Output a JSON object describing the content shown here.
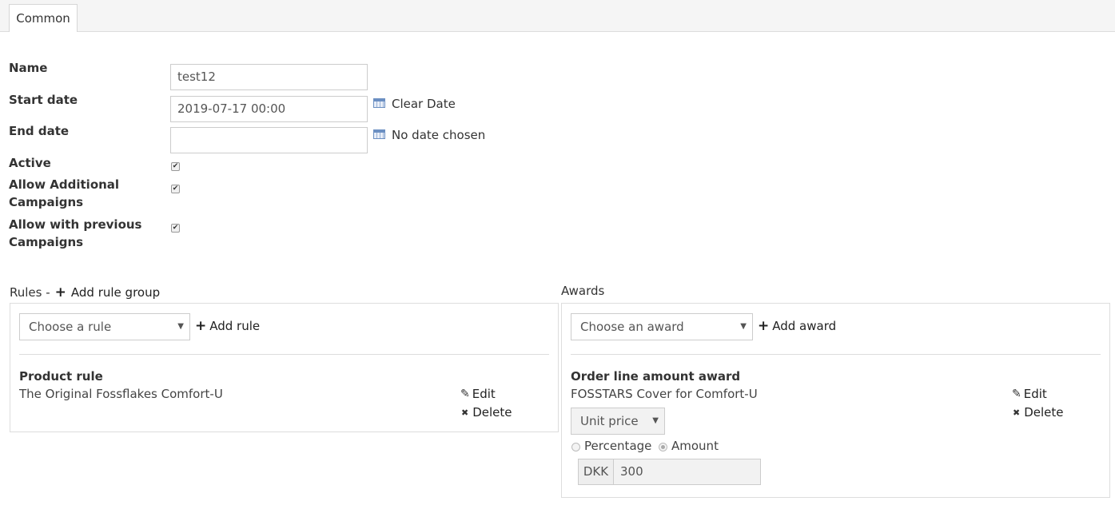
{
  "tabs": [
    {
      "label": "Common"
    }
  ],
  "form": {
    "name_label": "Name",
    "name_value": "test12",
    "start_label": "Start date",
    "start_value": "2019-07-17 00:00",
    "start_link": "Clear Date",
    "end_label": "End date",
    "end_value": "",
    "end_link": "No date chosen",
    "active_label": "Active",
    "active_checked": true,
    "allow_additional_label_1": "Allow Additional",
    "allow_additional_label_2": "Campaigns",
    "allow_additional_checked": true,
    "allow_previous_label_1": "Allow with previous",
    "allow_previous_label_2": "Campaigns",
    "allow_previous_checked": true
  },
  "rules": {
    "title": "Rules -",
    "add_group_label": "Add rule group",
    "select_placeholder": "Choose a rule",
    "add_label": "Add rule",
    "items": [
      {
        "title": "Product rule",
        "subtitle": "The Original Fossflakes Comfort-U",
        "edit": "Edit",
        "delete": "Delete"
      }
    ]
  },
  "awards": {
    "title": "Awards",
    "select_placeholder": "Choose an award",
    "add_label": "Add award",
    "items": [
      {
        "title": "Order line amount award",
        "subtitle": "FOSSTARS Cover for Comfort-U",
        "price_type": "Unit price",
        "radio_percentage": "Percentage",
        "radio_amount": "Amount",
        "selected_radio": "Amount",
        "currency": "DKK",
        "amount": "300",
        "edit": "Edit",
        "delete": "Delete"
      }
    ]
  },
  "icons": {
    "checkmark": "✔",
    "plus": "+",
    "pencil": "✎",
    "cross": "✖",
    "caret": "▼"
  }
}
